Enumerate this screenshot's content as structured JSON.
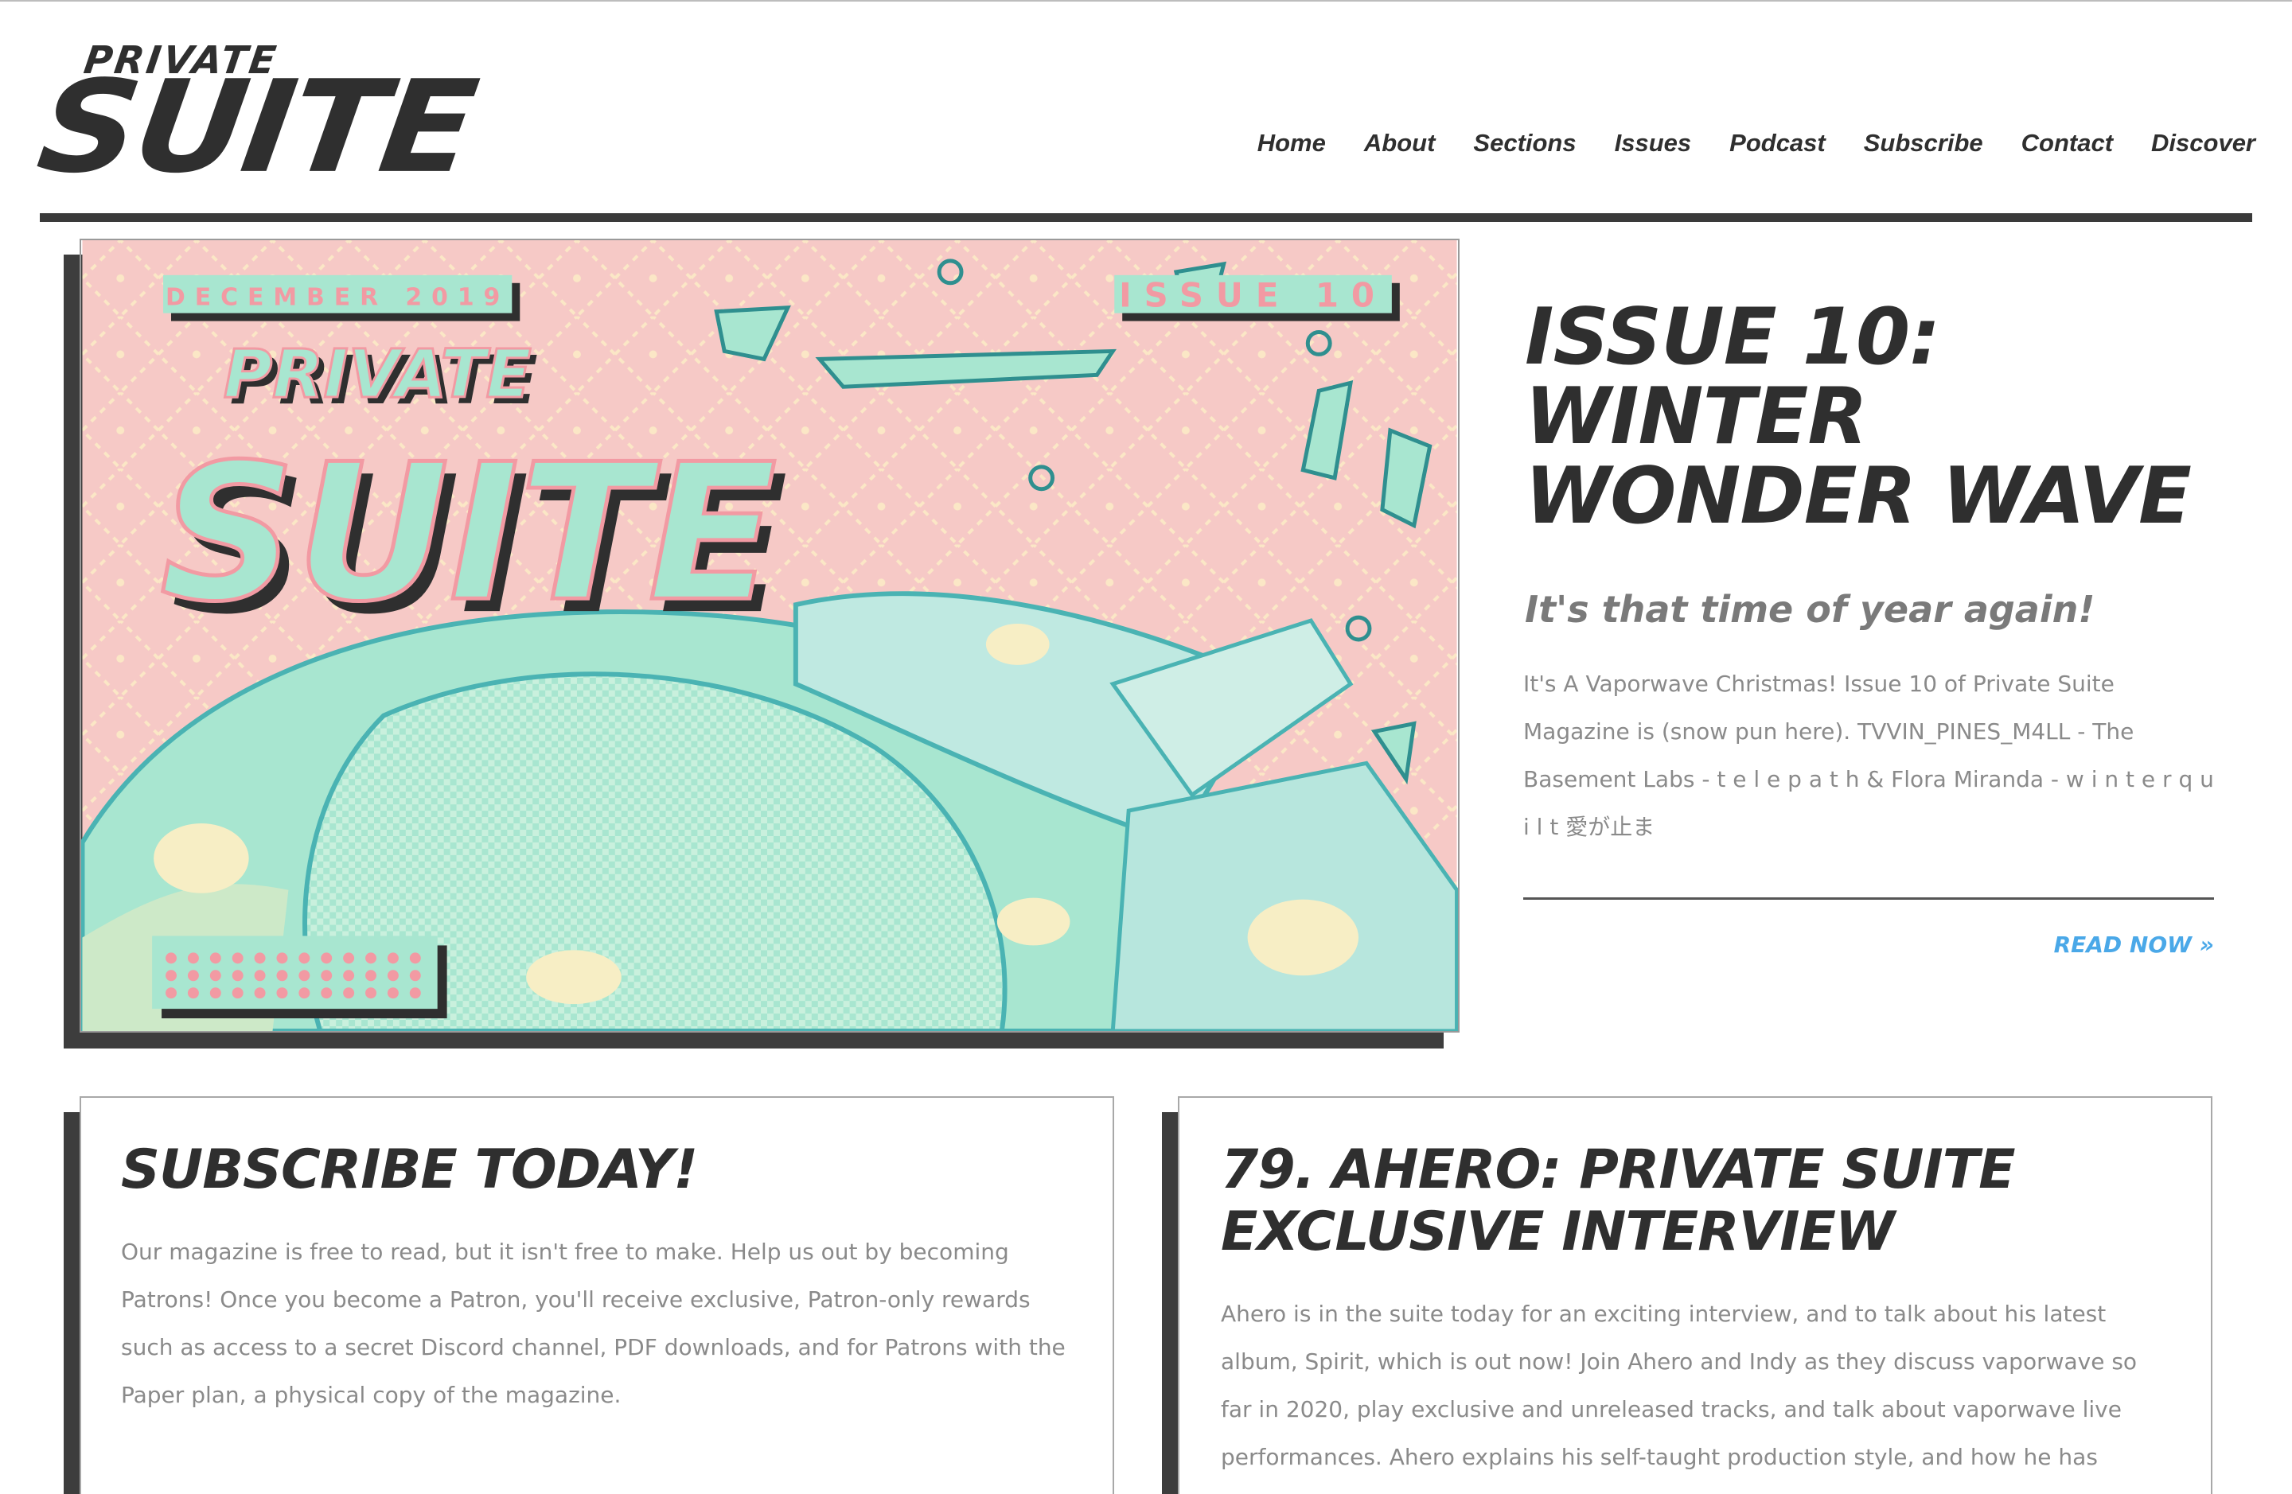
{
  "site": {
    "logo_small": "PRIVATE",
    "logo_big": "SUITE"
  },
  "nav": {
    "items": [
      {
        "label": "Home"
      },
      {
        "label": "About"
      },
      {
        "label": "Sections"
      },
      {
        "label": "Issues"
      },
      {
        "label": "Podcast"
      },
      {
        "label": "Subscribe"
      },
      {
        "label": "Contact"
      },
      {
        "label": "Discover"
      }
    ]
  },
  "hero": {
    "cover": {
      "date": "DECEMBER 2019",
      "issue": "ISSUE 10",
      "logo_small": "PRIVATE",
      "logo_big": "SUITE"
    },
    "title": "ISSUE 10: WINTER WONDER WAVE",
    "subtitle": "It's that time of year again!",
    "body": "It's A Vaporwave Christmas! Issue 10 of Private Suite Magazine is (snow pun here). TVVIN_PINES_M4LL - The Basement Labs - t e l e p a t h & Flora Miranda - w i n t e r q u i l t 愛が止ま",
    "read_more": "READ NOW »"
  },
  "cards": {
    "subscribe": {
      "title": "SUBSCRIBE TODAY!",
      "body": "Our magazine is free to read, but it isn't free to make. Help us out by becoming Patrons! Once you become a Patron, you'll receive exclusive, Patron-only rewards such as access to a secret Discord channel, PDF downloads, and for Patrons with the Paper plan, a physical copy of the magazine."
    },
    "podcast": {
      "title": "79. AHERO: PRIVATE SUITE EXCLUSIVE INTERVIEW",
      "body": "Ahero is in the suite today for an exciting interview, and to talk about his latest album, Spirit, which is out now! Join Ahero and Indy as they discuss vaporwave so far in 2020, play exclusive and unreleased tracks, and talk about vaporwave live performances. Ahero explains his self-taught production style, and how he has grown as a producer"
    }
  },
  "colors": {
    "dark": "#2f2f2f",
    "accent_link": "#4aa8e8",
    "cover_pink": "#f6c9c6",
    "cover_mint": "#a8e6d0"
  }
}
